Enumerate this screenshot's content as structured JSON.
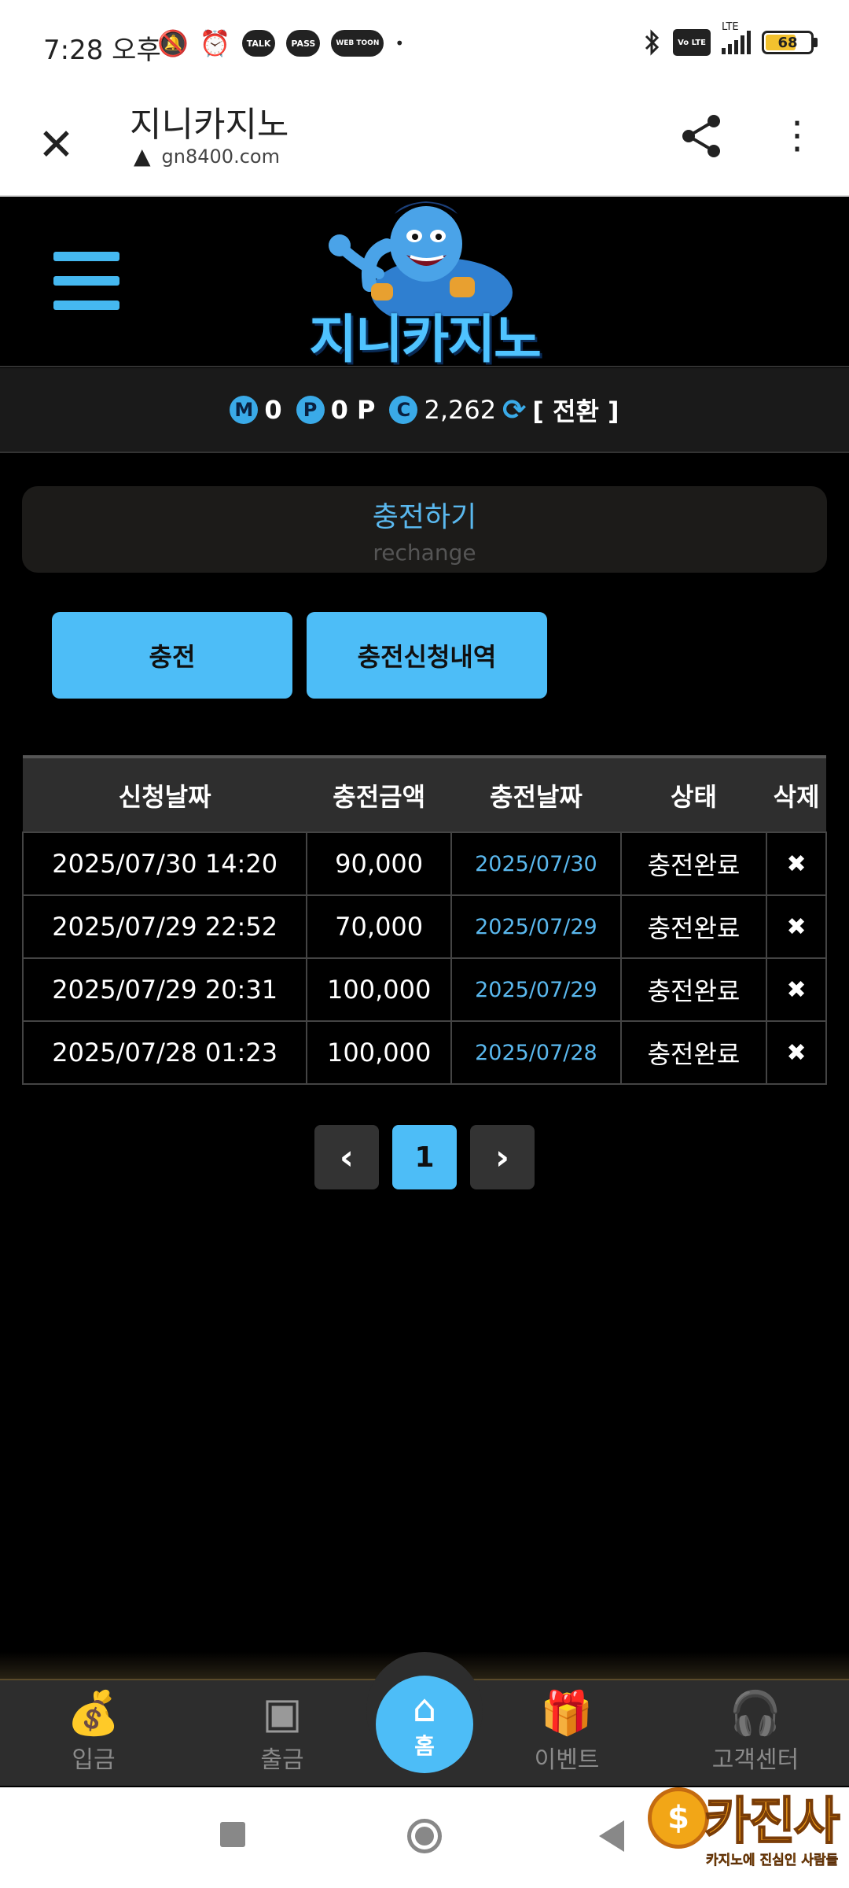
{
  "status_bar": {
    "time": "7:28 오후",
    "icons_left": [
      "mute-bell-icon",
      "alarm-icon",
      "talk-icon",
      "pass-icon",
      "webtoon-icon",
      "dot-icon"
    ],
    "talk_label": "TALK",
    "pass_label": "PASS",
    "webtoon_label": "WEB TOON",
    "volte_label": "Vo LTE",
    "lte_label": "LTE",
    "battery_level": "68"
  },
  "browser": {
    "title": "지니카지노",
    "url": "gn8400.com"
  },
  "site": {
    "logo_text": "지니카지노",
    "balance": {
      "m_badge": "M",
      "m_value": "0",
      "p_badge": "P",
      "p_value": "0 P",
      "c_badge": "C",
      "c_value": "2,262",
      "convert_label": "[ 전환 ]"
    },
    "section_title": "충전하기",
    "section_subtitle": "rechange",
    "buttons": {
      "charge": "충전",
      "history": "충전신청내역"
    },
    "table": {
      "headers": [
        "신청날짜",
        "충전금액",
        "충전날짜",
        "상태",
        "삭제"
      ],
      "rows": [
        {
          "request_date": "2025/07/30 14:20",
          "amount": "90,000",
          "charge_date": "2025/07/30",
          "status": "충전완료",
          "delete": "✖"
        },
        {
          "request_date": "2025/07/29 22:52",
          "amount": "70,000",
          "charge_date": "2025/07/29",
          "status": "충전완료",
          "delete": "✖"
        },
        {
          "request_date": "2025/07/29 20:31",
          "amount": "100,000",
          "charge_date": "2025/07/29",
          "status": "충전완료",
          "delete": "✖"
        },
        {
          "request_date": "2025/07/28 01:23",
          "amount": "100,000",
          "charge_date": "2025/07/28",
          "status": "충전완료",
          "delete": "✖"
        }
      ]
    },
    "pagination": {
      "prev": "‹",
      "current": "1",
      "next": "›"
    },
    "bottom_nav": [
      {
        "label": "입금",
        "icon": "money-bag-icon"
      },
      {
        "label": "출금",
        "icon": "safe-icon"
      },
      {
        "label": "홈",
        "icon": "home-icon"
      },
      {
        "label": "이벤트",
        "icon": "gift-icon"
      },
      {
        "label": "고객센터",
        "icon": "headset-icon"
      }
    ]
  },
  "watermark": {
    "title": "카진사",
    "subtitle": "카지노에 진심인 사람들",
    "coin_symbol": "$"
  },
  "colors": {
    "accent": "#4dbdf7",
    "background": "#000000",
    "header_row": "#2e2e2e",
    "link_date": "#5ab8ee"
  }
}
